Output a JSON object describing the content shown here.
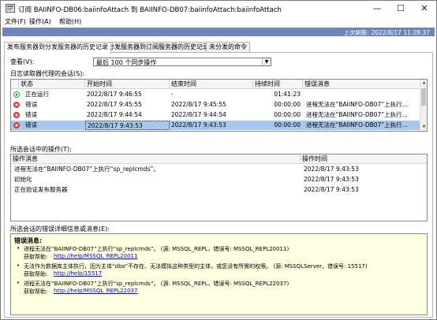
{
  "window": {
    "title": "订阅 BAIINFO-DB06:baiinfoAttach 到 BAIINFO-DB07:baiinfoAttach:baiinfoAttach",
    "minimize": "—",
    "maximize": "☐",
    "close": "✕"
  },
  "menu": {
    "file": "文件(F)",
    "action": "操作(A)",
    "help": "帮助(H)"
  },
  "status": {
    "last_refresh": "上次刷新: 2022/8/17 11:28:37"
  },
  "tabs": [
    {
      "label": "发布服务器到分发服务器的历史记录"
    },
    {
      "label": "分发服务器到订阅服务器的历史记录"
    },
    {
      "label": "未分发的命令"
    }
  ],
  "view": {
    "label": "查看(V):",
    "selected": "最后 100 个同步操作"
  },
  "sessions": {
    "title": "日志读取器代理的会话(S):",
    "columns": [
      "状态",
      "开始时间",
      "结束时间",
      "持续时间",
      "错误消息"
    ],
    "rows": [
      {
        "status": "正在运行",
        "icon": "running-icon",
        "start": "2022/8/17 9:46:55",
        "end": "-",
        "duration": "01:41:23",
        "error": ""
      },
      {
        "status": "错误",
        "icon": "error-icon",
        "start": "2022/8/17 9:45:55",
        "end": "2022/8/17 9:45:55",
        "duration": "00:00:00",
        "error": "进程无法在“BAIINFO-DB07”上执行..."
      },
      {
        "status": "错误",
        "icon": "error-icon",
        "start": "2022/8/17 9:44:54",
        "end": "2022/8/17 9:44:54",
        "duration": "00:00:00",
        "error": "进程无法在“BAIINFO-DB07”上执行..."
      },
      {
        "status": "错误",
        "icon": "error-icon",
        "start": "2022/8/17 9:43:53",
        "end": "2022/8/17 9:43:53",
        "duration": "00:00:00",
        "error": "进程无法在“BAIINFO-DB07”上执行..."
      }
    ]
  },
  "actions": {
    "title": "所选会话中的操作(T):",
    "columns": [
      "操作消息",
      "操作时间"
    ],
    "rows": [
      {
        "message": "进程无法在“BAIINFO-DB07”上执行“sp_replcmds”。",
        "time": "2022/8/17 9:43:53"
      },
      {
        "message": "初始化",
        "time": "2022/8/17 9:43:53"
      },
      {
        "message": "正在验证发布服务器",
        "time": "2022/8/17 9:43:53"
      }
    ]
  },
  "details": {
    "title": "所选会话的错误详细信息或消息(E):",
    "heading": "错误消息:",
    "items": [
      {
        "text": "进程无法在“BAIINFO-DB07”上执行“sp_replcmds”。 (源: MSSQL_REPL，错误号: MSSQL_REPL20011)",
        "help_label": "获取帮助:",
        "link": "http://help/MSSQL_REPL20011"
      },
      {
        "text": "无法作为数据库主体执行，因为主体“dbo”不存在、无法模拟这种类型的主体，或您没有所需的权限。 (源: MSSQLServer，错误号: 15517)",
        "help_label": "获取帮助:",
        "link": "http://help/15517"
      },
      {
        "text": "进程无法在“BAIINFO-DB07”上执行“sp_replcmds”。 (源: MSSQL_REPL，错误号: MSSQL_REPL22037)",
        "help_label": "获取帮助:",
        "link": "http://help/MSSQL_REPL22037"
      }
    ]
  },
  "colors": {
    "status_bar": "#6d85b8",
    "selection": "#a6c8ef",
    "error": "#d9363e",
    "running": "#2e9d3e",
    "info_bg": "#ffffe1"
  }
}
